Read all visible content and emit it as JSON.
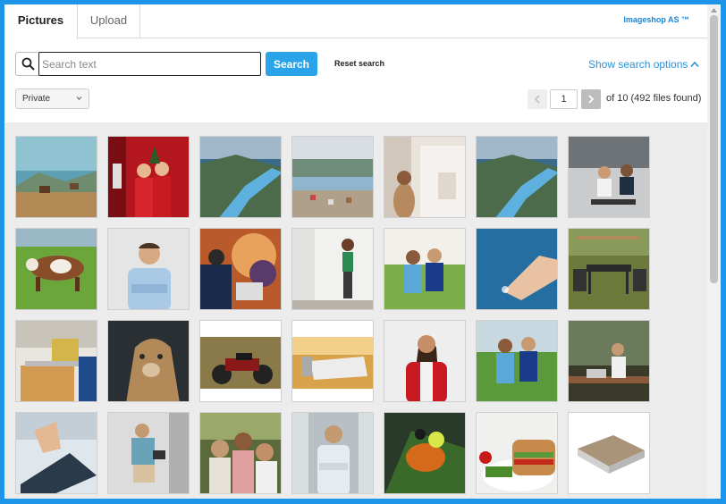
{
  "tabs": [
    {
      "label": "Pictures",
      "active": true
    },
    {
      "label": "Upload",
      "active": false
    }
  ],
  "brand": "Imageshop AS ™",
  "search": {
    "placeholder": "Search text",
    "value": "",
    "button_label": "Search",
    "reset_label": "Reset search",
    "options_label": "Show search options"
  },
  "filter": {
    "selected": "Private"
  },
  "pager": {
    "current_page": "1",
    "summary": "of 10 (492 files found)"
  },
  "thumbnails": [
    {
      "row": 1,
      "col": 1,
      "name": "thumb-cows-mountain"
    },
    {
      "row": 1,
      "col": 2,
      "name": "thumb-christmas-couple"
    },
    {
      "row": 1,
      "col": 3,
      "name": "thumb-fjord"
    },
    {
      "row": 1,
      "col": 4,
      "name": "thumb-coastal-town"
    },
    {
      "row": 1,
      "col": 5,
      "name": "thumb-woman-sketching"
    },
    {
      "row": 1,
      "col": 6,
      "name": "thumb-fjord-2"
    },
    {
      "row": 1,
      "col": 7,
      "name": "thumb-office-chairs"
    },
    {
      "row": 2,
      "col": 1,
      "name": "thumb-cow-pasture"
    },
    {
      "row": 2,
      "col": 2,
      "name": "thumb-man-arms-crossed"
    },
    {
      "row": 2,
      "col": 3,
      "name": "thumb-conference"
    },
    {
      "row": 2,
      "col": 4,
      "name": "thumb-woman-wall"
    },
    {
      "row": 2,
      "col": 5,
      "name": "thumb-footballers"
    },
    {
      "row": 2,
      "col": 6,
      "name": "thumb-touch-screen"
    },
    {
      "row": 2,
      "col": 7,
      "name": "thumb-patio-furniture"
    },
    {
      "row": 3,
      "col": 1,
      "name": "thumb-bakery"
    },
    {
      "row": 3,
      "col": 2,
      "name": "thumb-lioness"
    },
    {
      "row": 3,
      "col": 3,
      "name": "thumb-motorcycle"
    },
    {
      "row": 3,
      "col": 4,
      "name": "thumb-laptop-desk"
    },
    {
      "row": 3,
      "col": 5,
      "name": "thumb-woman-red-blazer"
    },
    {
      "row": 3,
      "col": 6,
      "name": "thumb-footballers-2"
    },
    {
      "row": 3,
      "col": 7,
      "name": "thumb-cafe-laptop"
    },
    {
      "row": 4,
      "col": 1,
      "name": "thumb-tablet-hand"
    },
    {
      "row": 4,
      "col": 2,
      "name": "thumb-man-tablet"
    },
    {
      "row": 4,
      "col": 3,
      "name": "thumb-family"
    },
    {
      "row": 4,
      "col": 4,
      "name": "thumb-businessman"
    },
    {
      "row": 4,
      "col": 5,
      "name": "thumb-soccer-ball"
    },
    {
      "row": 4,
      "col": 6,
      "name": "thumb-sandwich"
    },
    {
      "row": 4,
      "col": 7,
      "name": "thumb-floor-sample"
    }
  ],
  "colors": {
    "frame": "#1e95e8",
    "accent": "#2aa3e8",
    "link": "#2a92d8",
    "grid_bg": "#ececec"
  }
}
